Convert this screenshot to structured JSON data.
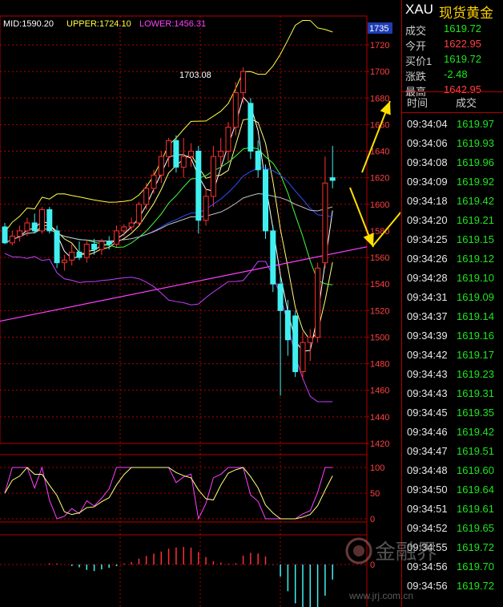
{
  "chart_data": {
    "type": "candlestick",
    "title": "",
    "indicator": {
      "mid_label": "MID:1590.20",
      "upper_label": "UPPER:1724.10",
      "lower_label": "LOWER:1456.31",
      "mid": 1590.2,
      "upper": 1724.1,
      "lower": 1456.31
    },
    "price_marker": "1735",
    "peak_label": "1703.08",
    "y_ticks": [
      "1720",
      "1700",
      "1680",
      "1660",
      "1640",
      "1620",
      "1600",
      "1580",
      "1560",
      "1540",
      "1520",
      "1500",
      "1480",
      "1460",
      "1440",
      "1420"
    ],
    "ylim": [
      1420,
      1735
    ],
    "kd_ticks": [
      "100",
      "50",
      "0"
    ],
    "macd_ticks": [
      "0"
    ],
    "candles": [
      {
        "o": 1583,
        "h": 1586,
        "l": 1570,
        "c": 1571
      },
      {
        "o": 1571,
        "h": 1580,
        "l": 1569,
        "c": 1576
      },
      {
        "o": 1576,
        "h": 1584,
        "l": 1572,
        "c": 1580
      },
      {
        "o": 1580,
        "h": 1590,
        "l": 1576,
        "c": 1586
      },
      {
        "o": 1586,
        "h": 1593,
        "l": 1578,
        "c": 1580
      },
      {
        "o": 1580,
        "h": 1598,
        "l": 1578,
        "c": 1596
      },
      {
        "o": 1596,
        "h": 1598,
        "l": 1578,
        "c": 1580
      },
      {
        "o": 1580,
        "h": 1584,
        "l": 1552,
        "c": 1556
      },
      {
        "o": 1556,
        "h": 1562,
        "l": 1550,
        "c": 1558
      },
      {
        "o": 1558,
        "h": 1570,
        "l": 1554,
        "c": 1564
      },
      {
        "o": 1564,
        "h": 1572,
        "l": 1558,
        "c": 1560
      },
      {
        "o": 1560,
        "h": 1573,
        "l": 1556,
        "c": 1570
      },
      {
        "o": 1570,
        "h": 1574,
        "l": 1562,
        "c": 1566
      },
      {
        "o": 1566,
        "h": 1574,
        "l": 1562,
        "c": 1572
      },
      {
        "o": 1572,
        "h": 1576,
        "l": 1566,
        "c": 1570
      },
      {
        "o": 1570,
        "h": 1584,
        "l": 1568,
        "c": 1580
      },
      {
        "o": 1580,
        "h": 1585,
        "l": 1576,
        "c": 1583
      },
      {
        "o": 1583,
        "h": 1590,
        "l": 1580,
        "c": 1586
      },
      {
        "o": 1586,
        "h": 1602,
        "l": 1584,
        "c": 1600
      },
      {
        "o": 1600,
        "h": 1616,
        "l": 1596,
        "c": 1612
      },
      {
        "o": 1612,
        "h": 1626,
        "l": 1608,
        "c": 1622
      },
      {
        "o": 1622,
        "h": 1640,
        "l": 1616,
        "c": 1636
      },
      {
        "o": 1636,
        "h": 1650,
        "l": 1628,
        "c": 1648
      },
      {
        "o": 1648,
        "h": 1652,
        "l": 1624,
        "c": 1628
      },
      {
        "o": 1628,
        "h": 1650,
        "l": 1620,
        "c": 1636
      },
      {
        "o": 1636,
        "h": 1646,
        "l": 1628,
        "c": 1640
      },
      {
        "o": 1640,
        "h": 1644,
        "l": 1578,
        "c": 1588
      },
      {
        "o": 1588,
        "h": 1612,
        "l": 1584,
        "c": 1606
      },
      {
        "o": 1606,
        "h": 1644,
        "l": 1598,
        "c": 1636
      },
      {
        "o": 1636,
        "h": 1650,
        "l": 1628,
        "c": 1640
      },
      {
        "o": 1640,
        "h": 1662,
        "l": 1632,
        "c": 1658
      },
      {
        "o": 1658,
        "h": 1692,
        "l": 1652,
        "c": 1684
      },
      {
        "o": 1684,
        "h": 1703,
        "l": 1676,
        "c": 1700
      },
      {
        "o": 1676,
        "h": 1680,
        "l": 1634,
        "c": 1640
      },
      {
        "o": 1640,
        "h": 1648,
        "l": 1620,
        "c": 1626
      },
      {
        "o": 1626,
        "h": 1630,
        "l": 1574,
        "c": 1580
      },
      {
        "o": 1580,
        "h": 1584,
        "l": 1534,
        "c": 1540
      },
      {
        "o": 1540,
        "h": 1546,
        "l": 1456,
        "c": 1520
      },
      {
        "o": 1520,
        "h": 1528,
        "l": 1486,
        "c": 1498
      },
      {
        "o": 1516,
        "h": 1520,
        "l": 1470,
        "c": 1474
      },
      {
        "o": 1474,
        "h": 1504,
        "l": 1468,
        "c": 1496
      },
      {
        "o": 1496,
        "h": 1506,
        "l": 1482,
        "c": 1500
      },
      {
        "o": 1500,
        "h": 1556,
        "l": 1496,
        "c": 1552
      },
      {
        "o": 1556,
        "h": 1636,
        "l": 1552,
        "c": 1616
      },
      {
        "o": 1620,
        "h": 1644,
        "l": 1612,
        "c": 1618
      }
    ]
  },
  "quote": {
    "symbol": "XAU",
    "name": "现货黄金",
    "rows": [
      {
        "label": "成交",
        "value": "1619.72",
        "color": "#1ee61e"
      },
      {
        "label": "今开",
        "value": "1622.95",
        "color": "#ff4040"
      },
      {
        "label": "买价1",
        "value": "1619.72",
        "color": "#1ee61e"
      },
      {
        "label": "涨跌",
        "value": "-2.48",
        "color": "#1ee61e"
      },
      {
        "label": "最高",
        "value": "1642.95",
        "color": "#ff4040"
      }
    ],
    "ticks_header": {
      "time": "时间",
      "price": "成交"
    },
    "ticks": [
      {
        "time": "09:34:04",
        "price": "1619.97"
      },
      {
        "time": "09:34:06",
        "price": "1619.93"
      },
      {
        "time": "09:34:08",
        "price": "1619.96"
      },
      {
        "time": "09:34:09",
        "price": "1619.92"
      },
      {
        "time": "09:34:18",
        "price": "1619.42"
      },
      {
        "time": "09:34:20",
        "price": "1619.21"
      },
      {
        "time": "09:34:25",
        "price": "1619.15"
      },
      {
        "time": "09:34:26",
        "price": "1619.12"
      },
      {
        "time": "09:34:28",
        "price": "1619.10"
      },
      {
        "time": "09:34:31",
        "price": "1619.09"
      },
      {
        "time": "09:34:37",
        "price": "1619.14"
      },
      {
        "time": "09:34:39",
        "price": "1619.16"
      },
      {
        "time": "09:34:42",
        "price": "1619.17"
      },
      {
        "time": "09:34:43",
        "price": "1619.23"
      },
      {
        "time": "09:34:43",
        "price": "1619.31"
      },
      {
        "time": "09:34:45",
        "price": "1619.35"
      },
      {
        "time": "09:34:46",
        "price": "1619.42"
      },
      {
        "time": "09:34:47",
        "price": "1619.51"
      },
      {
        "time": "09:34:48",
        "price": "1619.60"
      },
      {
        "time": "09:34:50",
        "price": "1619.64"
      },
      {
        "time": "09:34:51",
        "price": "1619.61"
      },
      {
        "time": "09:34:52",
        "price": "1619.65"
      },
      {
        "time": "09:34:55",
        "price": "1619.72"
      },
      {
        "time": "09:34:56",
        "price": "1619.70"
      },
      {
        "time": "09:34:56",
        "price": "1619.72"
      }
    ]
  },
  "watermark": {
    "text": "金融界",
    "url": "www.jrj.com.cn"
  },
  "colors": {
    "up": "#ff3030",
    "down": "#40f0f0",
    "grid": "#b30000",
    "mid": "#ff40ff",
    "upper": "#ffff40",
    "lower": "#c040ff"
  }
}
